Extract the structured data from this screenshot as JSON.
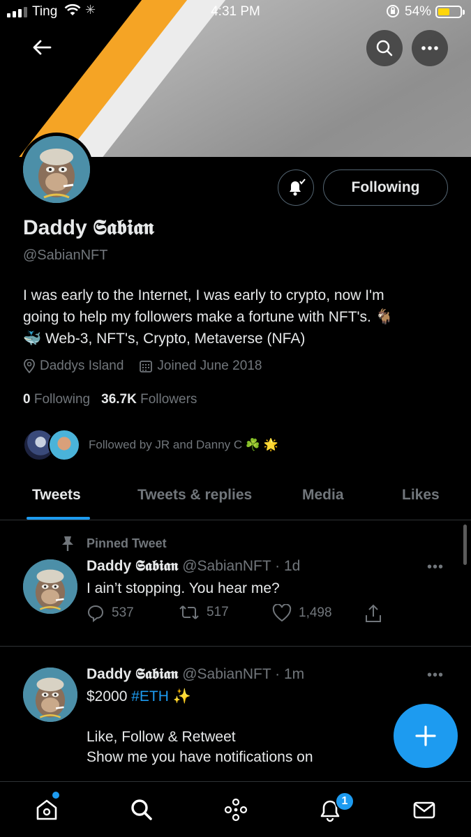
{
  "status_bar": {
    "carrier": "Ting",
    "time": "4:31 PM",
    "battery": "54%",
    "battery_level": 0.54
  },
  "profile": {
    "display_name": "Daddy 𝕾𝖆𝖇𝖎𝖆𝖓",
    "handle": "@SabianNFT",
    "follow_button": "Following",
    "bio_lines": [
      "I was early to the Internet, I was early to crypto, now I'm",
      "going to help my followers make a fortune with NFT's. 🐐",
      "🐳 Web-3, NFT's, Crypto, Metaverse (NFA)"
    ],
    "location": "Daddys Island",
    "joined": "Joined June 2018",
    "following_count": "0",
    "following_label": "Following",
    "followers_count": "36.7K",
    "followers_label": "Followers",
    "followed_by": "Followed by JR and Danny C ☘️ 🌟"
  },
  "tabs": [
    {
      "label": "Tweets",
      "active": true
    },
    {
      "label": "Tweets & replies",
      "active": false
    },
    {
      "label": "Media",
      "active": false
    },
    {
      "label": "Likes",
      "active": false
    }
  ],
  "tweets": [
    {
      "pinned_label": "Pinned Tweet",
      "name": "Daddy 𝕾𝖆𝖇𝖎𝖆𝖓",
      "meta": "@SabianNFT · 1d",
      "text": "I ain’t stopping. You hear me?",
      "replies": "537",
      "retweets": "517",
      "likes": "1,498"
    },
    {
      "name": "Daddy 𝕾𝖆𝖇𝖎𝖆𝖓",
      "meta": "@SabianNFT · 1m",
      "text_prefix": "$2000",
      "hashtag": "#ETH",
      "text_suffix": "✨",
      "line2": "Like, Follow & Retweet",
      "line3": "Show me you have notifications on"
    }
  ],
  "more_glyph": "•••",
  "nav": {
    "notification_badge": "1"
  },
  "colors": {
    "accent": "#1d9bf0",
    "background": "#000000",
    "secondary_text": "#71767b",
    "banner_orange": "#f5a425"
  }
}
